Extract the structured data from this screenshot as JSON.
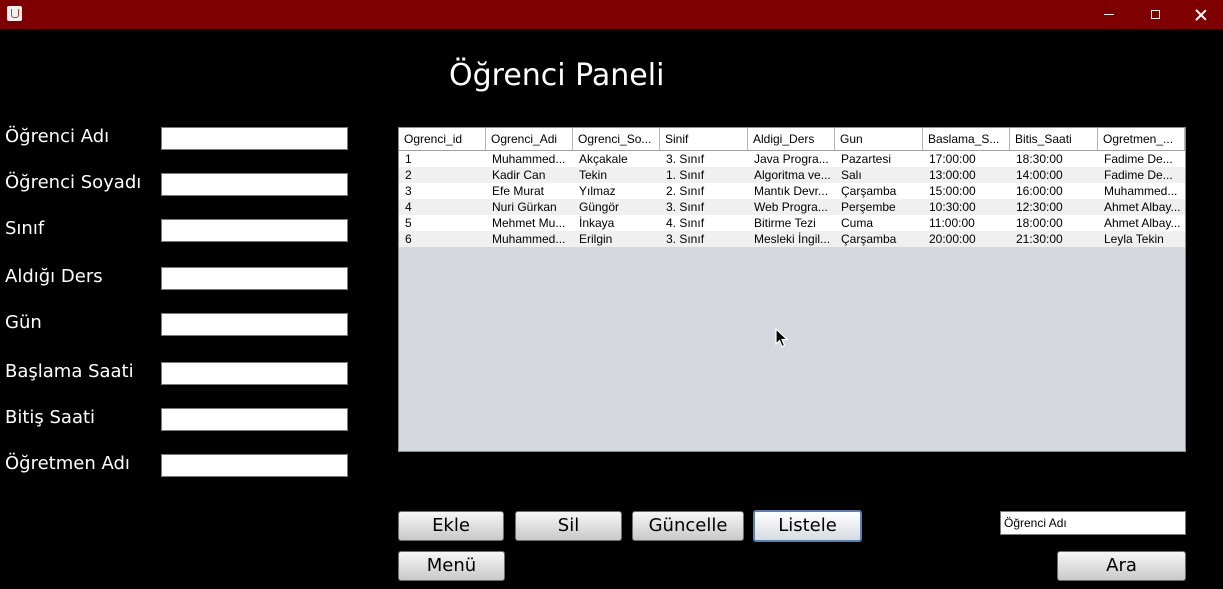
{
  "window": {
    "icon": "java-cup-icon",
    "controls": {
      "minimize": "minimize-icon",
      "maximize": "maximize-icon",
      "close": "close-icon"
    }
  },
  "panel": {
    "title": "Öğrenci Paneli"
  },
  "form": {
    "fields": [
      {
        "label": "Öğrenci Adı",
        "value": ""
      },
      {
        "label": "Öğrenci Soyadı",
        "value": ""
      },
      {
        "label": "Sınıf",
        "value": ""
      },
      {
        "label": "Aldığı Ders",
        "value": ""
      },
      {
        "label": "Gün",
        "value": ""
      },
      {
        "label": "Başlama Saati",
        "value": ""
      },
      {
        "label": "Bitiş Saati",
        "value": ""
      },
      {
        "label": "Öğretmen Adı",
        "value": ""
      }
    ]
  },
  "table": {
    "columns": [
      "Ogrenci_id",
      "Ogrenci_Adi",
      "Ogrenci_So...",
      "Sinif",
      "Aldigi_Ders",
      "Gun",
      "Baslama_S...",
      "Bitis_Saati",
      "Ogretmen_..."
    ],
    "rows": [
      [
        "1",
        "Muhammed...",
        "Akçakale",
        "3. Sınıf",
        "Java Progra...",
        "Pazartesi",
        "17:00:00",
        "18:30:00",
        "Fadime De..."
      ],
      [
        "2",
        "Kadir Can",
        "Tekin",
        "1. Sınıf",
        "Algoritma ve...",
        "Salı",
        "13:00:00",
        "14:00:00",
        "Fadime De..."
      ],
      [
        "3",
        "Efe Murat",
        "Yılmaz",
        "2. Sınıf",
        "Mantık Devr...",
        "Çarşamba",
        "15:00:00",
        "16:00:00",
        "Muhammed..."
      ],
      [
        "4",
        "Nuri Gürkan",
        "Güngör",
        "3. Sınıf",
        "Web Progra...",
        "Perşembe",
        "10:30:00",
        "12:30:00",
        "Ahmet Albay..."
      ],
      [
        "5",
        "Mehmet Mu...",
        "İnkaya",
        "4. Sınıf",
        "Bitirme Tezi",
        "Cuma",
        "11:00:00",
        "18:00:00",
        "Ahmet Albay..."
      ],
      [
        "6",
        "Muhammed...",
        "Erilgin",
        "3. Sınıf",
        "Mesleki İngil...",
        "Çarşamba",
        "20:00:00",
        "21:30:00",
        "Leyla Tekin"
      ]
    ]
  },
  "buttons": {
    "add": "Ekle",
    "delete": "Sil",
    "update": "Güncelle",
    "list": "Listele",
    "menu": "Menü",
    "search": "Ara"
  },
  "search": {
    "value": "Öğrenci Adı"
  },
  "colors": {
    "titlebar": "#7f0000",
    "background": "#000000",
    "table_bg": "#d5d8de"
  }
}
